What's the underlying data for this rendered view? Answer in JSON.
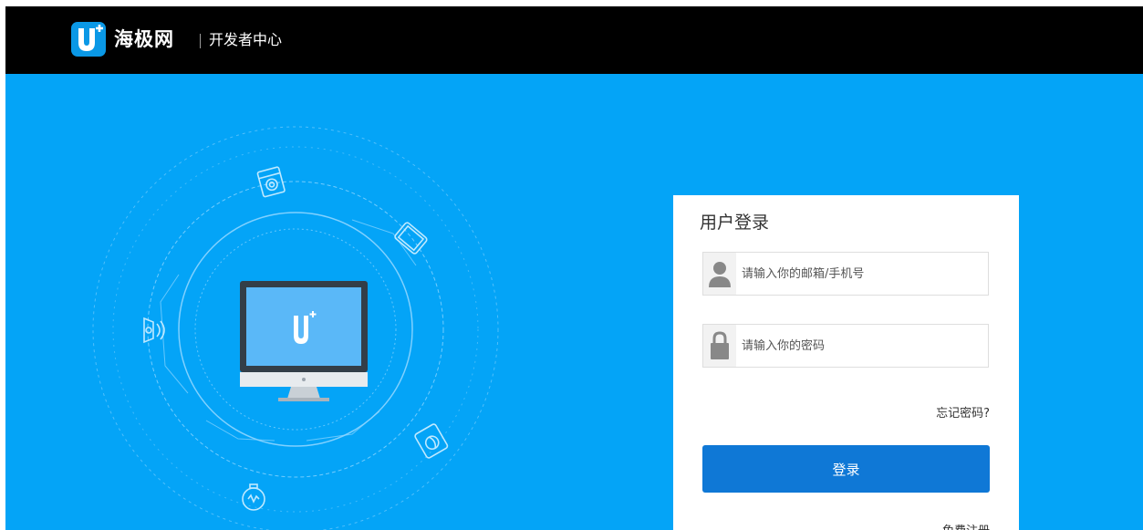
{
  "header": {
    "brand_name": "海极网",
    "subtitle": "开发者中心",
    "logo_letter": "U"
  },
  "login": {
    "title": "用户登录",
    "account_placeholder": "请输入你的邮箱/手机号",
    "password_placeholder": "请输入你的密码",
    "forgot_label": "忘记密码?",
    "submit_label": "登录",
    "register_label": "免费注册"
  },
  "icons": [
    "user-icon",
    "lock-icon",
    "monitor-icon",
    "washing-machine-icon",
    "tablet-icon",
    "router-icon",
    "fan-icon",
    "watch-icon"
  ],
  "colors": {
    "hero_bg": "#04a4f7",
    "topbar_bg": "#000000",
    "primary_button": "#0f78d6",
    "logo_blue": "#0a98e6"
  }
}
